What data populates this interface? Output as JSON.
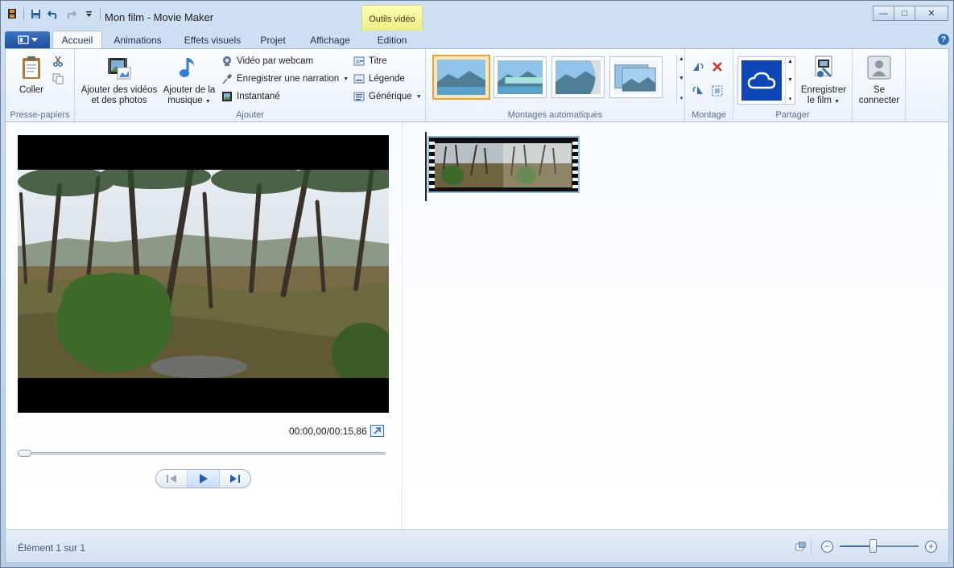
{
  "window": {
    "title": "Mon film - Movie Maker",
    "contextual_tab_header": "Outils vidéo",
    "controls": {
      "minimize": "—",
      "maximize": "□",
      "close": "✕"
    }
  },
  "quick_access": {
    "icons": [
      "save-icon",
      "undo-icon",
      "redo-icon",
      "customize-icon"
    ]
  },
  "tabs": [
    {
      "label": "Accueil",
      "active": true
    },
    {
      "label": "Animations",
      "active": false
    },
    {
      "label": "Effets visuels",
      "active": false
    },
    {
      "label": "Projet",
      "active": false
    },
    {
      "label": "Affichage",
      "active": false
    },
    {
      "label": "Edition",
      "active": false
    }
  ],
  "ribbon": {
    "clipboard": {
      "label": "Presse-papiers",
      "paste": "Coller"
    },
    "add": {
      "label": "Ajouter",
      "add_videos_line1": "Ajouter des vidéos",
      "add_videos_line2": "et des photos",
      "add_music_line1": "Ajouter de la",
      "add_music_line2": "musique",
      "webcam": "Vidéo par webcam",
      "narration": "Enregistrer une narration",
      "snapshot": "Instantané",
      "title": "Titre",
      "caption": "Légende",
      "credits": "Générique"
    },
    "automovie": {
      "label": "Montages automatiques",
      "selected_index": 0
    },
    "editing": {
      "label": "Montage"
    },
    "share": {
      "label": "Partager",
      "save_line1": "Enregistrer",
      "save_line2": "le film"
    },
    "signin": {
      "line1": "Se",
      "line2": "connecter"
    }
  },
  "preview": {
    "timecode": "00:00,00/00:15,86",
    "seek_position": 0
  },
  "status": {
    "text": "Élément 1 sur 1",
    "zoom_level": 0.42
  },
  "colors": {
    "accent": "#2f6fc4",
    "selected_theme_border": "#e8a33d",
    "clip_border": "#85bde8",
    "contextual_tab": "#f3f38f"
  }
}
